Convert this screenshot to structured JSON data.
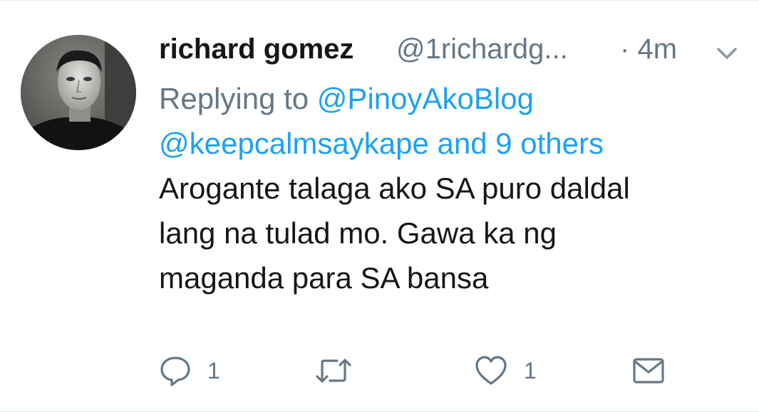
{
  "tweet": {
    "display_name": "richard gomez",
    "handle": "@1richardg...",
    "separator": "·",
    "time": "4m",
    "reply_prefix": "Replying to",
    "mentions": [
      "@PinoyAkoBlog",
      "@keepcalmsaykape"
    ],
    "and_others": "and 9 others",
    "body_lines": [
      "Arogante talaga ako SA puro daldal",
      "lang na tulad mo. Gawa ka ng",
      "maganda para SA bansa"
    ]
  },
  "actions": {
    "reply_count": "1",
    "retweet_count": "",
    "like_count": "1",
    "reply_icon": "reply-icon",
    "retweet_icon": "retweet-icon",
    "like_icon": "heart-icon",
    "dm_icon": "envelope-icon"
  },
  "colors": {
    "link": "#1da1f2",
    "secondary": "#657786",
    "text": "#14171a"
  }
}
